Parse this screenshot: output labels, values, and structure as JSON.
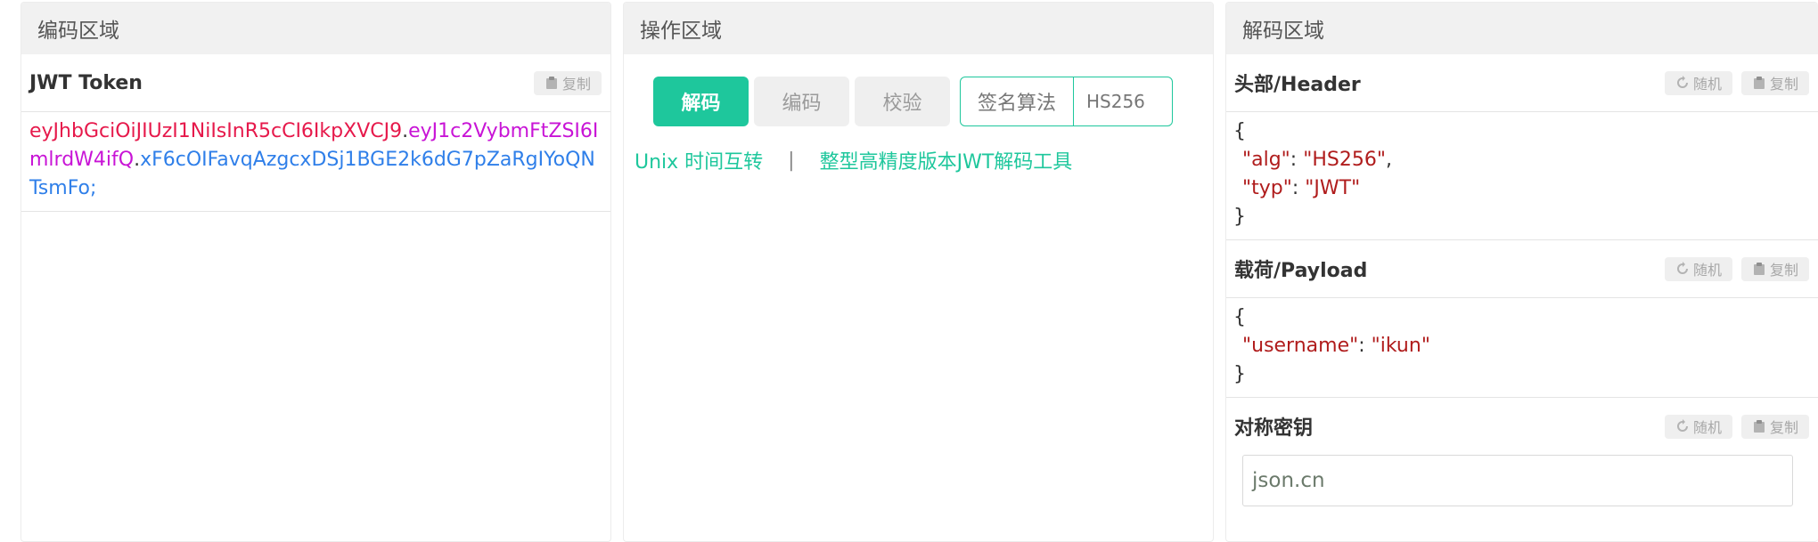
{
  "encode": {
    "title": "编码区域",
    "token_label": "JWT Token",
    "copy_label": "复制",
    "token": {
      "header": "eyJhbGciOiJIUzI1NiIsInR5cCI6IkpXVCJ9",
      "payload": "eyJ1c2VybmFtZSI6ImlrdW4ifQ",
      "signature": "xF6cOIFavqAzgcxDSj1BGE2k6dG7pZaRgIYoQNTsmFo;",
      "dot": "."
    }
  },
  "ops": {
    "title": "操作区域",
    "decode_label": "解码",
    "encode_label": "编码",
    "verify_label": "校验",
    "alg_label": "签名算法",
    "alg_value": "HS256",
    "link_unix": "Unix 时间互转",
    "link_sep": "|",
    "link_bigint": "整型高精度版本JWT解码工具"
  },
  "decode": {
    "title": "解码区域",
    "random_label": "随机",
    "copy_label": "复制",
    "header": {
      "title": "头部/Header",
      "open": "{",
      "close": "}",
      "alg_key": "\"alg\"",
      "alg_val": "\"HS256\"",
      "typ_key": "\"typ\"",
      "typ_val": "\"JWT\"",
      "colon": ": ",
      "comma": ","
    },
    "payload": {
      "title": "载荷/Payload",
      "open": "{",
      "close": "}",
      "username_key": "\"username\"",
      "username_val": "\"ikun\"",
      "colon": ": "
    },
    "secret": {
      "title": "对称密钥",
      "value": "json.cn"
    }
  },
  "colors": {
    "accent": "#1ec79c",
    "token_header": "#e6194b",
    "token_payload": "#c814d6",
    "token_signature": "#2f7fe9",
    "json_string": "#b01c1c"
  },
  "icons": {
    "copy": "clipboard-icon",
    "random": "refresh-icon"
  }
}
